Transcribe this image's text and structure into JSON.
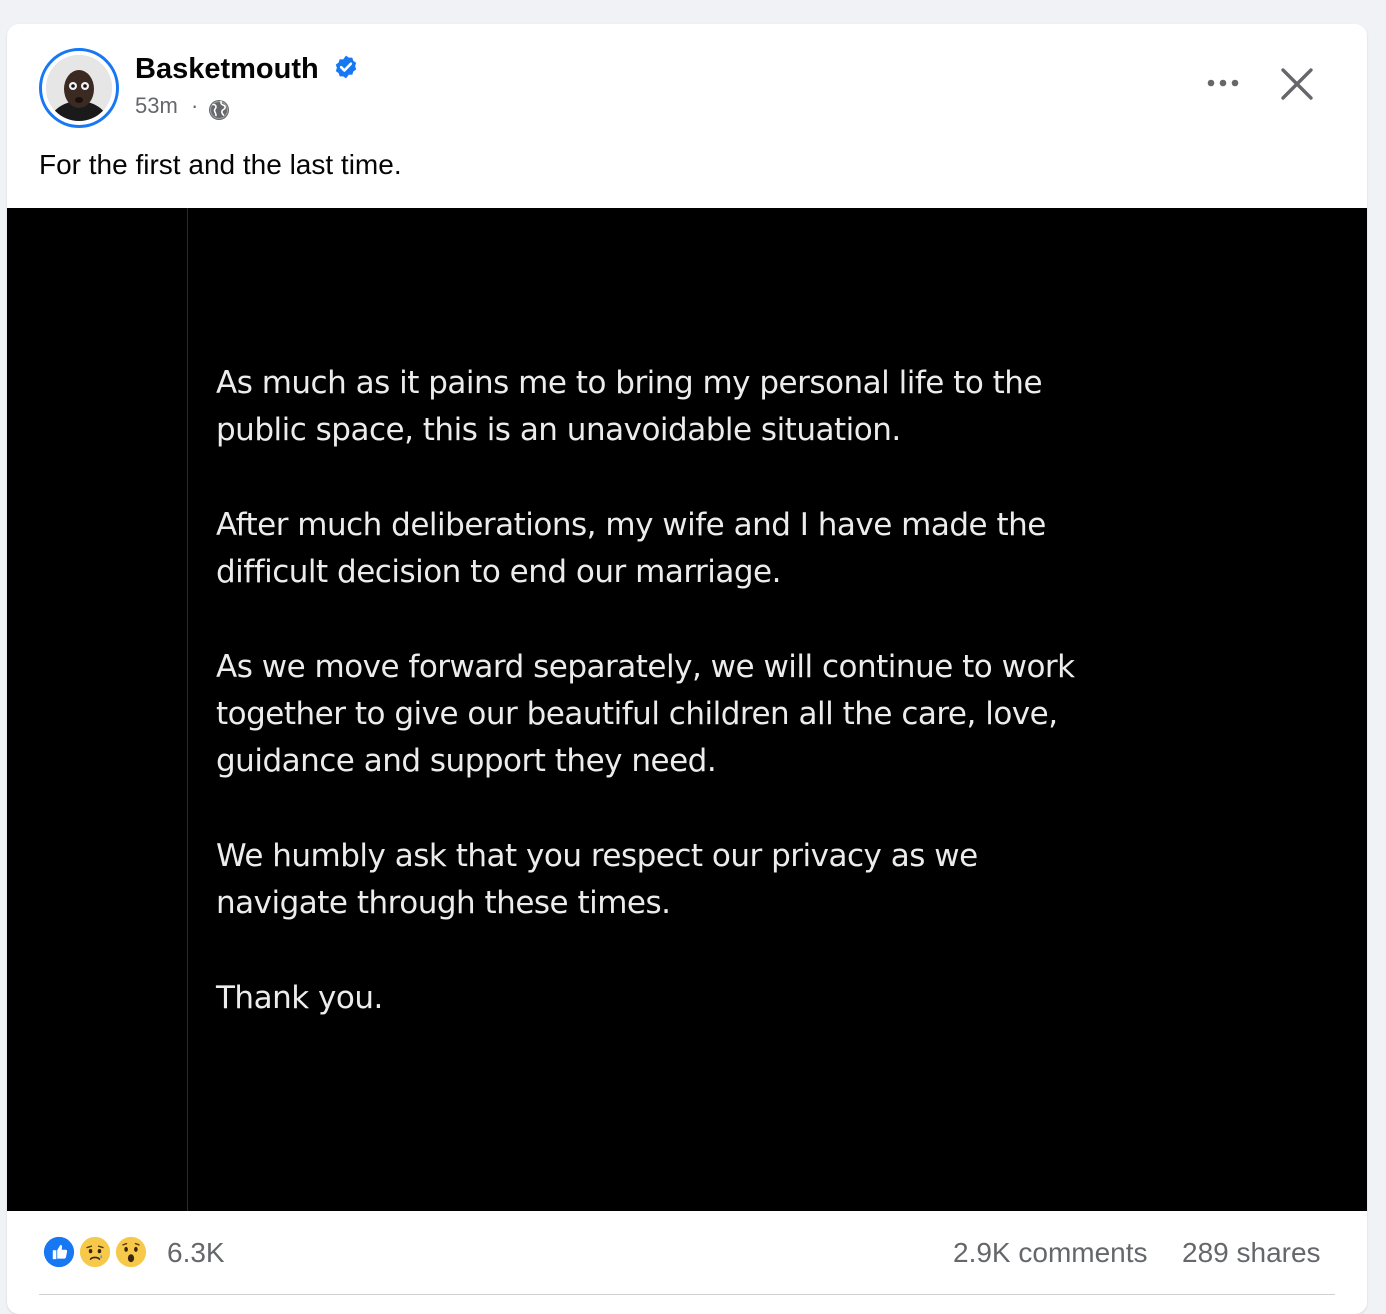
{
  "post": {
    "author": "Basketmouth",
    "verified": true,
    "time": "53m",
    "separator": "·",
    "audience_icon": "globe-icon",
    "caption": "For the first and the last time."
  },
  "image": {
    "paragraphs": [
      "As much as it pains me to bring my personal life to the public space, this is an unavoidable situation.",
      "After much deliberations, my wife and I have made the difficult  decision to end our marriage.",
      "As we move forward separately, we will continue to work together to give our beautiful children all the care, love, guidance and support they need.",
      "We humbly ask that you respect our privacy as we navigate through these times.",
      "Thank you."
    ]
  },
  "stats": {
    "reactions": [
      "like",
      "sad",
      "wow"
    ],
    "reaction_count": "6.3K",
    "comments": "2.9K comments",
    "shares": "289 shares"
  },
  "colors": {
    "brand_blue": "#1877f2",
    "secondary_text": "#65676b",
    "primary_text": "#050505"
  }
}
